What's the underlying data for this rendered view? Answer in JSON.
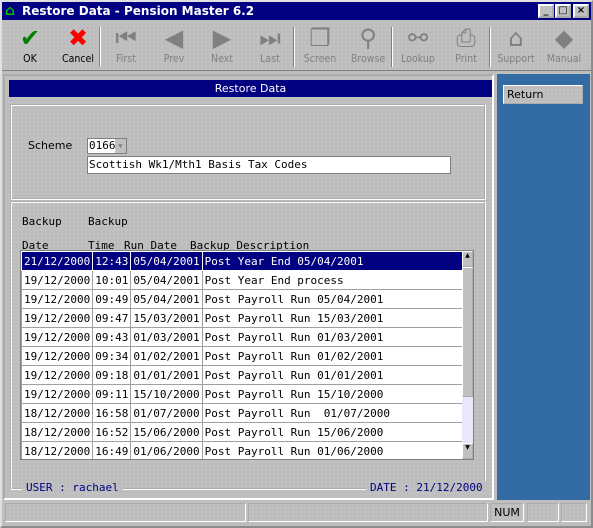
{
  "window": {
    "title": "Restore Data - Pension Master 6.2",
    "controls": [
      "_",
      "□",
      "×"
    ]
  },
  "toolbar": [
    {
      "label": "OK",
      "icon": "check-icon",
      "enabled": true,
      "color": "#008000"
    },
    {
      "label": "Cancel",
      "icon": "x-icon",
      "enabled": true,
      "color": "#ff0000"
    },
    {
      "label": "First",
      "icon": "first-icon",
      "enabled": false
    },
    {
      "label": "Prev",
      "icon": "prev-icon",
      "enabled": false
    },
    {
      "label": "Next",
      "icon": "next-icon",
      "enabled": false
    },
    {
      "label": "Last",
      "icon": "last-icon",
      "enabled": false
    },
    {
      "label": "Screen",
      "icon": "screen-icon",
      "enabled": false
    },
    {
      "label": "Browse",
      "icon": "magnifier-icon",
      "enabled": false
    },
    {
      "label": "Lookup",
      "icon": "binoculars-icon",
      "enabled": false
    },
    {
      "label": "Print",
      "icon": "printer-icon",
      "enabled": false
    },
    {
      "label": "Support",
      "icon": "support-icon",
      "enabled": false
    },
    {
      "label": "Manual",
      "icon": "book-icon",
      "enabled": false
    }
  ],
  "header": "Restore Data",
  "side": {
    "return_label": "Return",
    "color": "#336ba5"
  },
  "scheme": {
    "label": "Scheme",
    "code": "0166",
    "description": "Scottish Wk1/Mth1 Basis Tax Codes"
  },
  "table": {
    "headers": [
      [
        "Backup",
        "Date"
      ],
      [
        "Backup",
        "Time"
      ],
      [
        "",
        "Run Date"
      ],
      [
        "",
        "Backup Description"
      ]
    ],
    "rows": [
      [
        "21/12/2000",
        "12:43",
        "05/04/2001",
        "Post Year End 05/04/2001"
      ],
      [
        "19/12/2000",
        "10:01",
        "05/04/2001",
        "Post Year End process"
      ],
      [
        "19/12/2000",
        "09:49",
        "05/04/2001",
        "Post Payroll Run 05/04/2001"
      ],
      [
        "19/12/2000",
        "09:47",
        "15/03/2001",
        "Post Payroll Run 15/03/2001"
      ],
      [
        "19/12/2000",
        "09:43",
        "01/03/2001",
        "Post Payroll Run 01/03/2001"
      ],
      [
        "19/12/2000",
        "09:34",
        "01/02/2001",
        "Post Payroll Run 01/02/2001"
      ],
      [
        "19/12/2000",
        "09:18",
        "01/01/2001",
        "Post Payroll Run 01/01/2001"
      ],
      [
        "19/12/2000",
        "09:11",
        "15/10/2000",
        "Post Payroll Run 15/10/2000"
      ],
      [
        "18/12/2000",
        "16:58",
        "01/07/2000",
        "Post Payroll Run  01/07/2000"
      ],
      [
        "18/12/2000",
        "16:52",
        "15/06/2000",
        "Post Payroll Run 15/06/2000"
      ],
      [
        "18/12/2000",
        "16:49",
        "01/06/2000",
        "Post Payroll Run 01/06/2000"
      ]
    ],
    "selected_row": 0
  },
  "footer": {
    "user": "USER : rachael",
    "date": "DATE : 21/12/2000"
  },
  "statusbar": {
    "num": "NUM"
  }
}
